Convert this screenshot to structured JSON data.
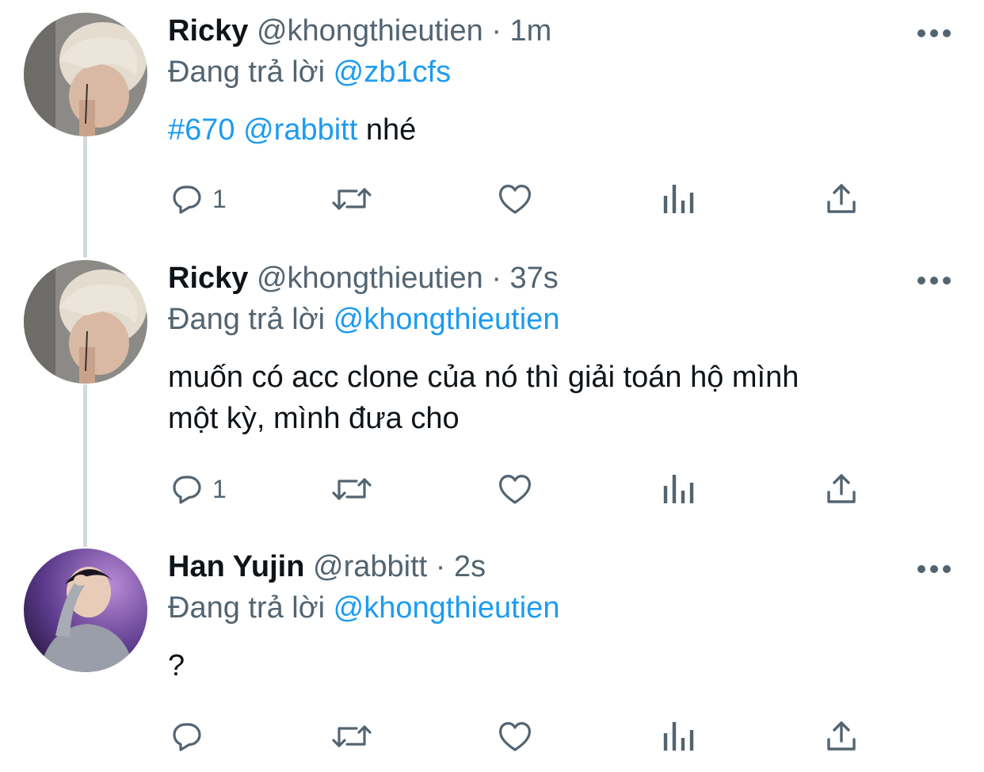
{
  "thread": [
    {
      "name": "Ricky",
      "handle": "@khongthieutien",
      "sep": "·",
      "time": "1m",
      "reply_prefix": "Đang trả lời",
      "reply_to": "@zb1cfs",
      "text_segments": [
        {
          "text": "#670",
          "type": "hashtag"
        },
        {
          "text": " ",
          "type": "plain"
        },
        {
          "text": "@rabbitt",
          "type": "mention"
        },
        {
          "text": " nhé",
          "type": "plain"
        }
      ],
      "reply_count": "1"
    },
    {
      "name": "Ricky",
      "handle": "@khongthieutien",
      "sep": "·",
      "time": "37s",
      "reply_prefix": "Đang trả lời",
      "reply_to": "@khongthieutien",
      "text_line1": "muốn có acc clone của nó thì giải toán hộ mình",
      "text_line2": "một kỳ, mình đưa cho",
      "reply_count": "1"
    },
    {
      "name": "Han Yujin",
      "handle": "@rabbitt",
      "sep": "·",
      "time": "2s",
      "reply_prefix": "Đang trả lời",
      "reply_to": "@khongthieutien",
      "text": "?",
      "reply_count": ""
    }
  ],
  "icons": {
    "reply": "reply-icon",
    "retweet": "retweet-icon",
    "like": "like-icon",
    "analytics": "analytics-icon",
    "share": "share-icon",
    "more": "more-icon"
  },
  "colors": {
    "link": "#1d9bf0",
    "meta": "#536471",
    "thread_line": "#cfd9de"
  }
}
